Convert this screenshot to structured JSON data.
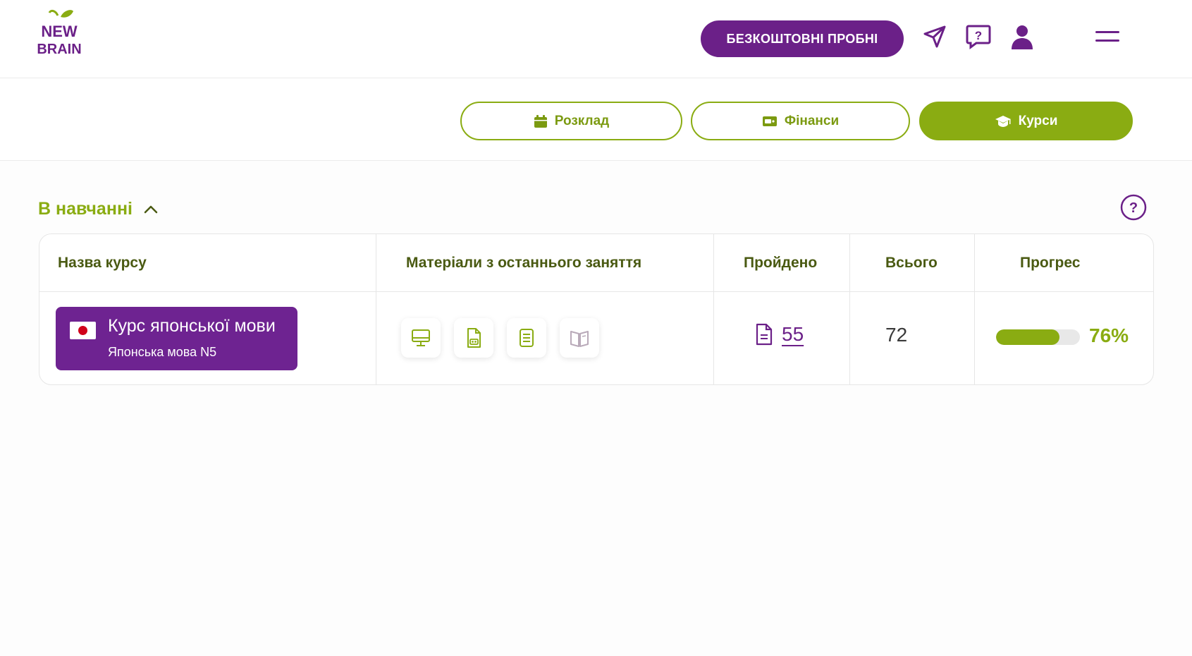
{
  "header": {
    "logo_text": [
      "NEW",
      "BRAIN"
    ],
    "trial_button": "БЕЗКОШТОВНІ ПРОБНІ",
    "icons": [
      "send-icon",
      "help-chat-icon",
      "user-icon",
      "menu-icon"
    ]
  },
  "nav": {
    "schedule": "Розклад",
    "finance": "Фінанси",
    "courses": "Курси",
    "active": "courses"
  },
  "section": {
    "title": "В навчанні"
  },
  "table": {
    "headers": {
      "course_name": "Назва курсу",
      "materials": "Матеріали з останнього заняття",
      "passed": "Пройдено",
      "total": "Всього",
      "progress": "Прогрес"
    },
    "rows": [
      {
        "course_title": "Курс японської мови",
        "course_subtitle": "Японська мова N5",
        "flag": "japan",
        "materials": [
          "monitor-icon",
          "audio-file-icon",
          "notes-icon",
          "book-icon"
        ],
        "passed": "55",
        "total": "72",
        "progress_value": 0.76,
        "progress_text": "76%"
      }
    ]
  },
  "colors": {
    "purple": "#6b2088",
    "green": "#8aac12",
    "header_text": "#4a5a12"
  }
}
